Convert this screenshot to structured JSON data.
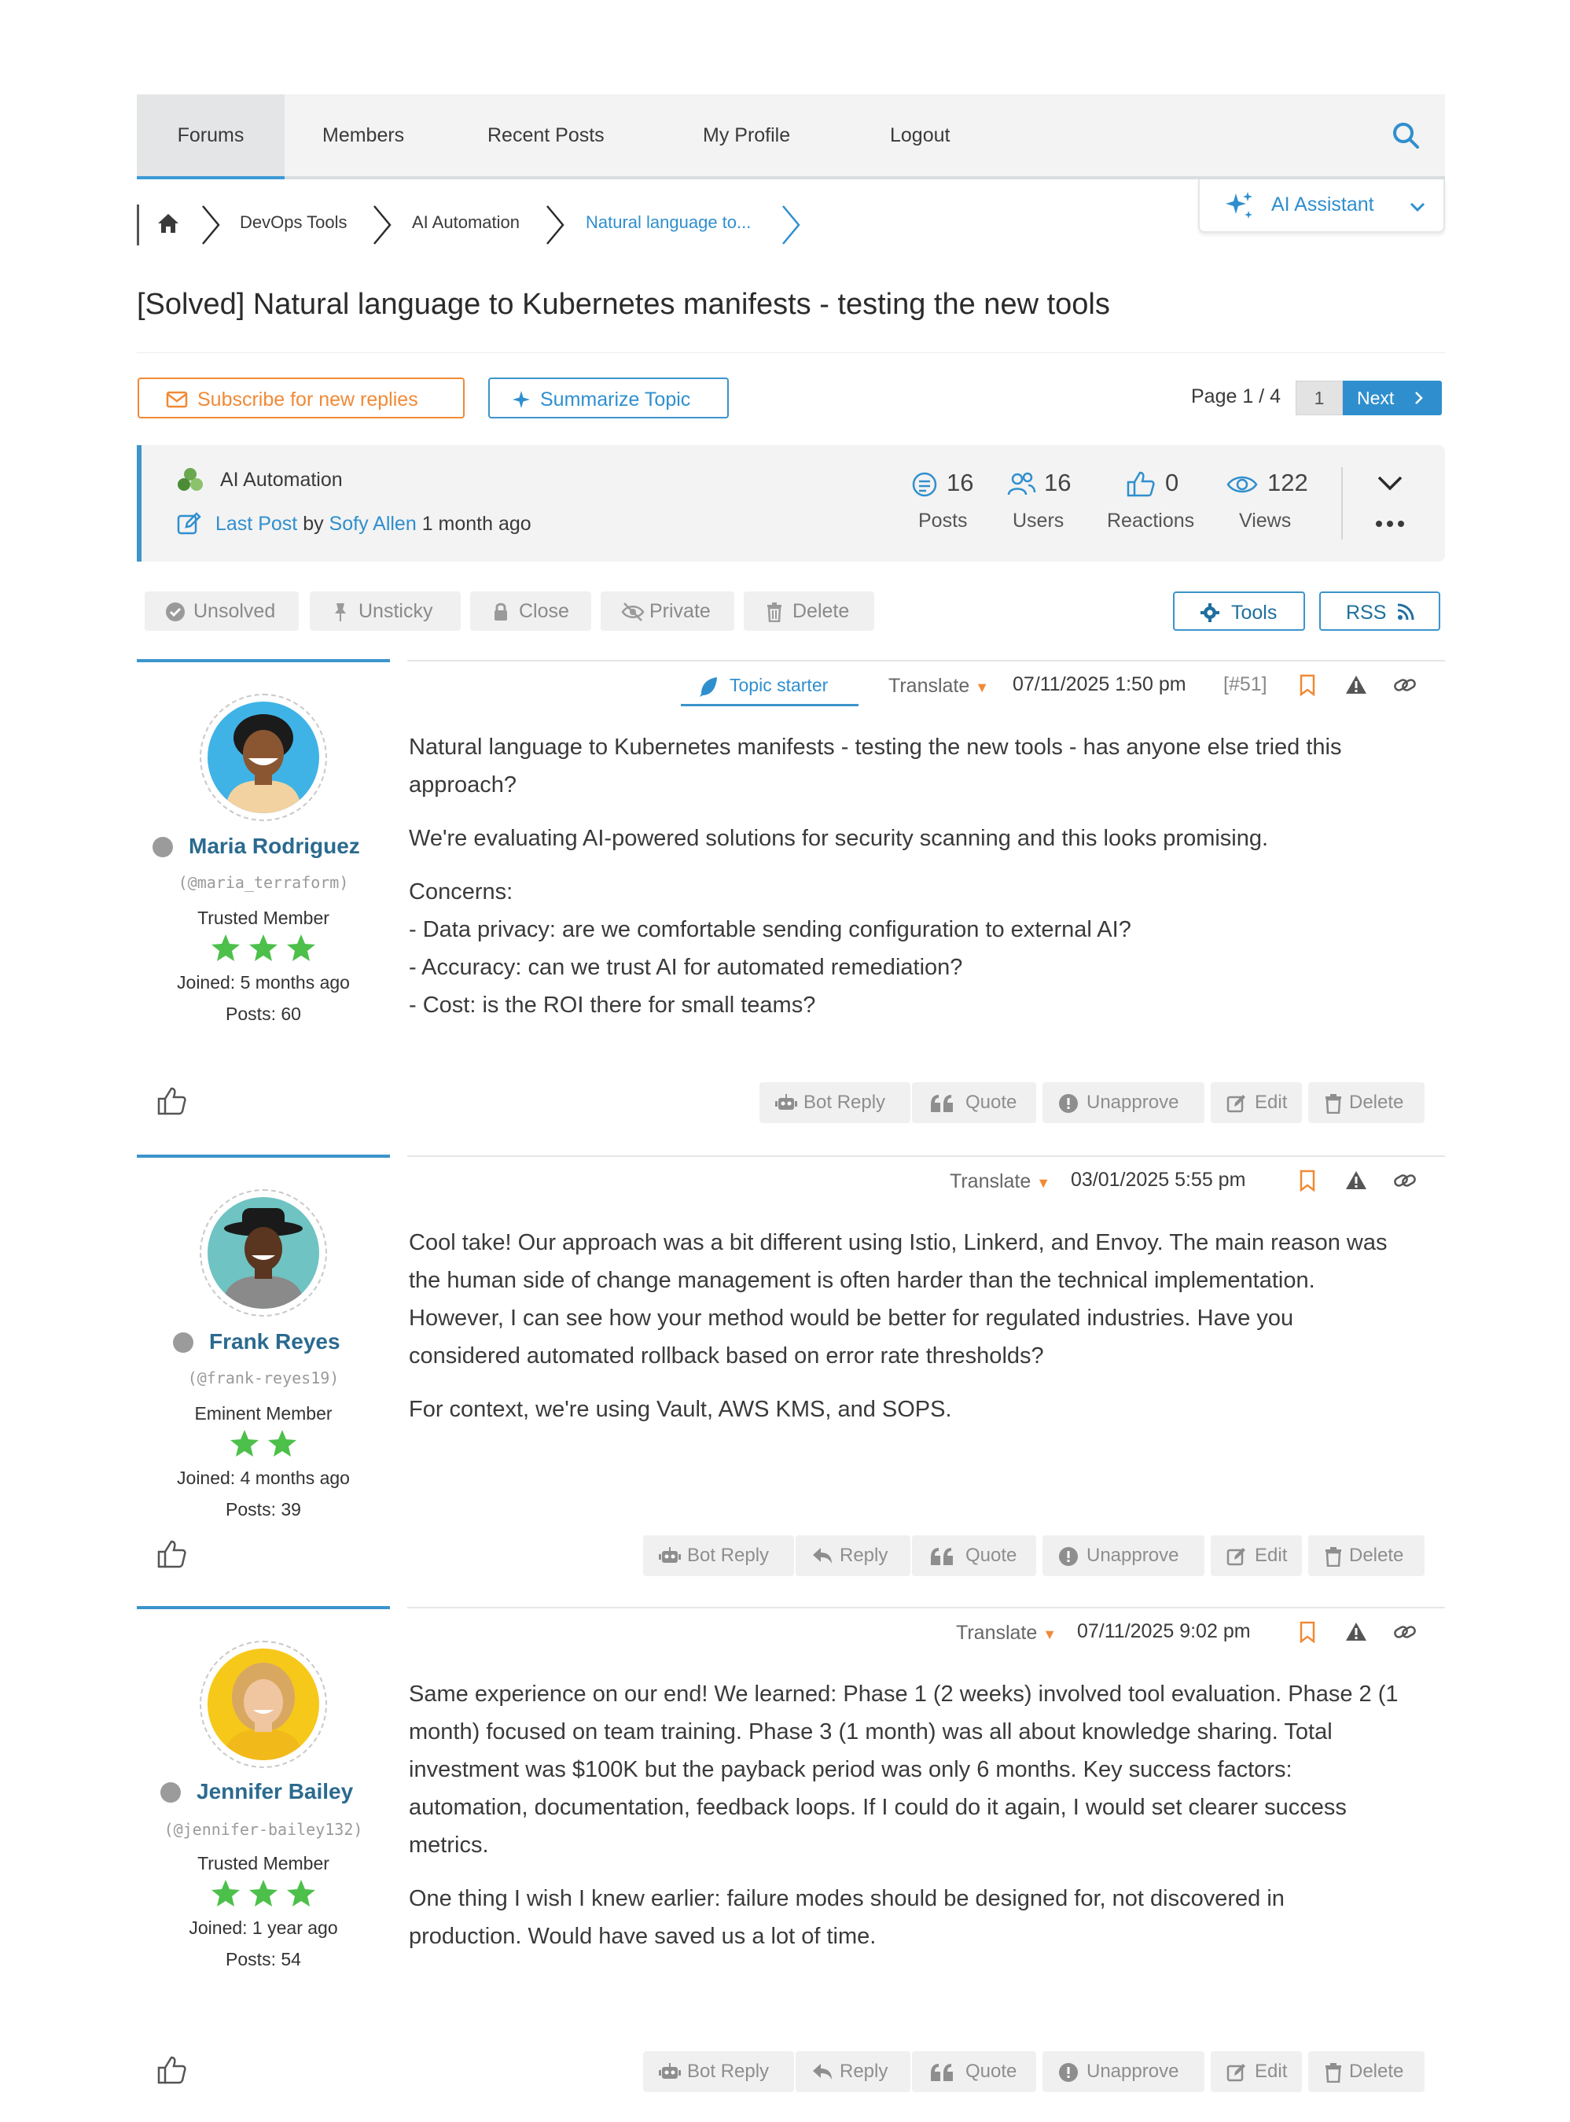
{
  "nav": {
    "items": [
      "Forums",
      "Members",
      "Recent Posts",
      "My Profile",
      "Logout"
    ],
    "active": "Forums"
  },
  "ai_assistant": {
    "label": "AI Assistant"
  },
  "breadcrumb": {
    "items": [
      "DevOps Tools",
      "AI Automation",
      "Natural language to..."
    ]
  },
  "topic": {
    "title": "[Solved] Natural language to Kubernetes manifests - testing the new tools",
    "subscribe_label": "Subscribe for new replies",
    "summarize_label": "Summarize Topic"
  },
  "pager": {
    "label": "Page 1 / 4",
    "current": "1",
    "next_label": "Next"
  },
  "stats": {
    "forum": "AI Automation",
    "last_post_label": "Last Post",
    "last_post_by": "by",
    "last_post_user": "Sofy Allen",
    "last_post_time": "1 month ago",
    "posts_value": "16",
    "posts_label": "Posts",
    "users_value": "16",
    "users_label": "Users",
    "reactions_value": "0",
    "reactions_label": "Reactions",
    "views_value": "122",
    "views_label": "Views"
  },
  "admin": {
    "unsolved": "Unsolved",
    "unsticky": "Unsticky",
    "close": "Close",
    "private": "Private",
    "delete": "Delete",
    "tools": "Tools",
    "rss": "RSS"
  },
  "colors": {
    "accent": "#2f8fce",
    "orange": "#f08a36",
    "star": "#4cc04a",
    "name": "#2b6a8f"
  },
  "posts": [
    {
      "author": "Maria Rodriguez",
      "handle": "(@maria_terraform)",
      "rank": "Trusted Member",
      "stars": 3,
      "joined": "Joined: 5 months ago",
      "post_count": "Posts: 60",
      "topic_starter": "Topic starter",
      "translate": "Translate",
      "date": "07/11/2025 1:50 pm",
      "number": "[#51]",
      "body": [
        "Natural language to Kubernetes manifests - testing the new tools - has anyone else tried this approach?",
        "We're evaluating AI-powered solutions for security scanning and this looks promising.",
        "Concerns:",
        "- Data privacy: are we comfortable sending configuration to external AI?",
        "- Accuracy: can we trust AI for automated remediation?",
        "- Cost: is the ROI there for small teams?"
      ],
      "actions": [
        "Bot Reply",
        "Quote",
        "Unapprove",
        "Edit",
        "Delete"
      ]
    },
    {
      "author": "Frank Reyes",
      "handle": "(@frank-reyes19)",
      "rank": "Eminent Member",
      "stars": 2,
      "joined": "Joined: 4 months ago",
      "post_count": "Posts: 39",
      "translate": "Translate",
      "date": "03/01/2025 5:55 pm",
      "body": [
        "Cool take! Our approach was a bit different using Istio, Linkerd, and Envoy. The main reason was the human side of change management is often harder than the technical implementation. However, I can see how your method would be better for regulated industries. Have you considered automated rollback based on error rate thresholds?",
        "For context, we're using Vault, AWS KMS, and SOPS."
      ],
      "actions": [
        "Bot Reply",
        "Reply",
        "Quote",
        "Unapprove",
        "Edit",
        "Delete"
      ]
    },
    {
      "author": "Jennifer Bailey",
      "handle": "(@jennifer-bailey132)",
      "rank": "Trusted Member",
      "stars": 3,
      "joined": "Joined: 1 year ago",
      "post_count": "Posts: 54",
      "translate": "Translate",
      "date": "07/11/2025 9:02 pm",
      "body": [
        "Same experience on our end! We learned: Phase 1 (2 weeks) involved tool evaluation. Phase 2 (1 month) focused on team training. Phase 3 (1 month) was all about knowledge sharing. Total investment was $100K but the payback period was only 6 months. Key success factors: automation, documentation, feedback loops. If I could do it again, I would set clearer success metrics.",
        "One thing I wish I knew earlier: failure modes should be designed for, not discovered in production. Would have saved us a lot of time."
      ],
      "actions": [
        "Bot Reply",
        "Reply",
        "Quote",
        "Unapprove",
        "Edit",
        "Delete"
      ]
    }
  ]
}
